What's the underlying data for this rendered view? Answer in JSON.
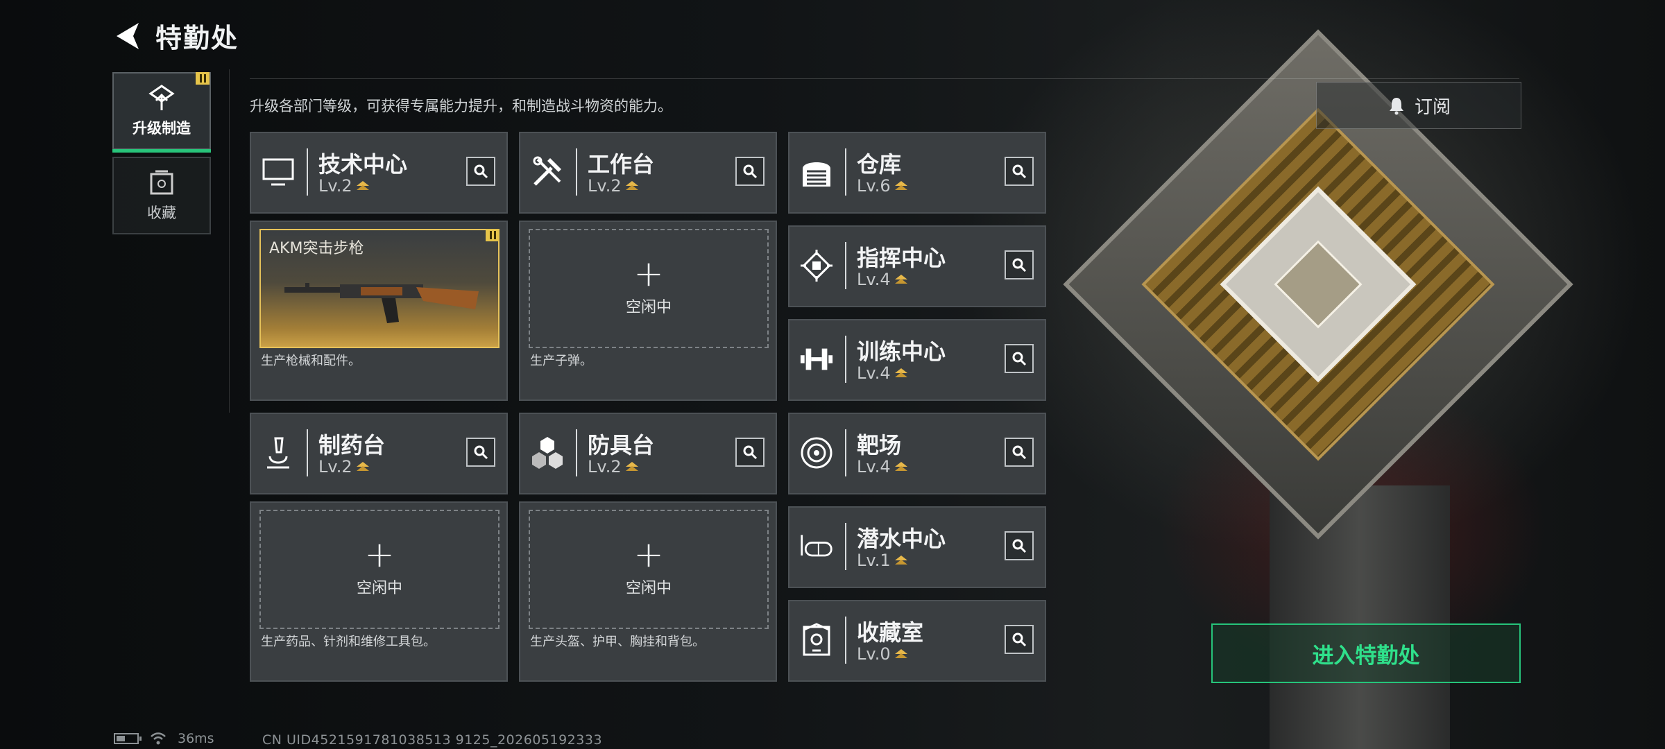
{
  "header": {
    "title": "特勤处"
  },
  "sidebar": {
    "items": [
      {
        "label": "升级制造",
        "active": true,
        "icon": "upgrade-icon"
      },
      {
        "label": "收藏",
        "active": false,
        "icon": "collection-icon"
      }
    ]
  },
  "description": "升级各部门等级，可获得专属能力提升，和制造战斗物资的能力。",
  "subscribe": {
    "label": "订阅",
    "icon": "bell-icon"
  },
  "departments": {
    "tech": {
      "name": "技术中心",
      "level": "Lv.2",
      "icon": "monitor-icon",
      "desc": "生产枪械和配件。",
      "producing": "AKM突击步枪"
    },
    "workbench": {
      "name": "工作台",
      "level": "Lv.2",
      "icon": "tools-icon",
      "desc": "生产子弹。",
      "idle": "空闲中"
    },
    "pharmacy": {
      "name": "制药台",
      "level": "Lv.2",
      "icon": "microscope-icon",
      "desc": "生产药品、针剂和维修工具包。",
      "idle": "空闲中"
    },
    "armor": {
      "name": "防具台",
      "level": "Lv.2",
      "icon": "hexagons-icon",
      "desc": "生产头盔、护甲、胸挂和背包。",
      "idle": "空闲中"
    },
    "warehouse": {
      "name": "仓库",
      "level": "Lv.6",
      "icon": "warehouse-icon"
    },
    "command": {
      "name": "指挥中心",
      "level": "Lv.4",
      "icon": "chip-icon"
    },
    "training": {
      "name": "训练中心",
      "level": "Lv.4",
      "icon": "dumbbell-icon"
    },
    "range": {
      "name": "靶场",
      "level": "Lv.4",
      "icon": "target-icon"
    },
    "diving": {
      "name": "潜水中心",
      "level": "Lv.1",
      "icon": "diving-mask-icon"
    },
    "collection": {
      "name": "收藏室",
      "level": "Lv.0",
      "icon": "trophy-icon"
    }
  },
  "enter_button": "进入特勤处",
  "status_bar": {
    "ping": "36ms",
    "uid": "CN UID4521591781038513 9125_202605192333"
  },
  "colors": {
    "accent_green": "#28c47a",
    "level_gold": "#e7b84a"
  }
}
